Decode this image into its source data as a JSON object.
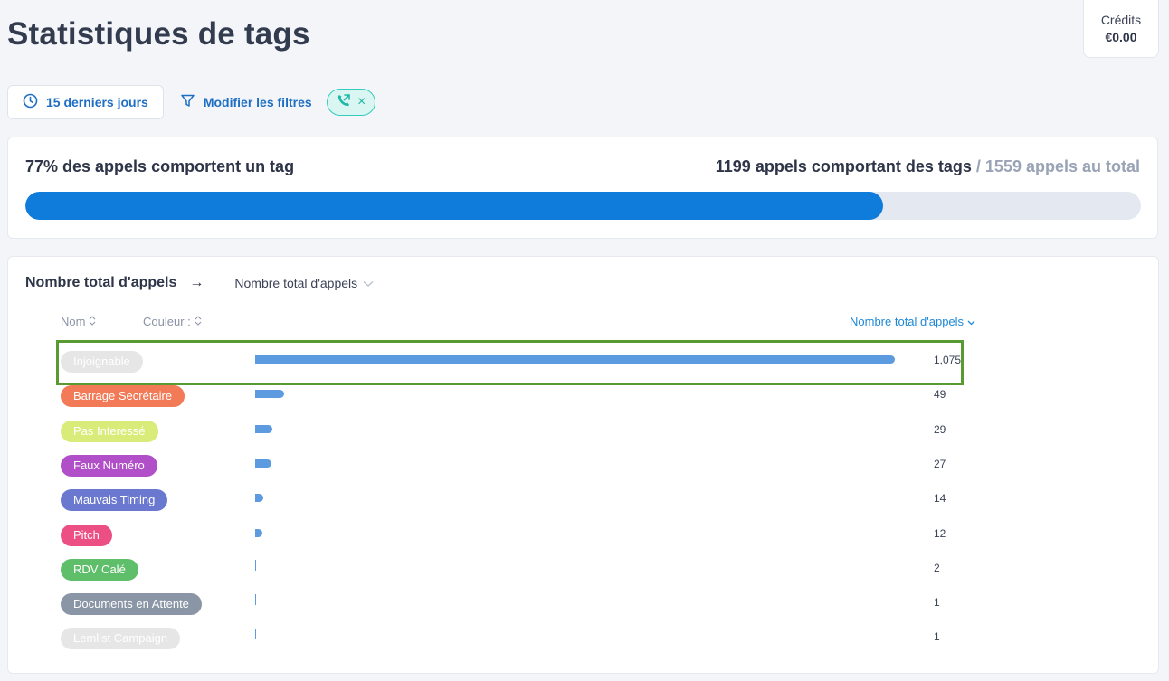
{
  "page": {
    "title": "Statistiques de tags"
  },
  "credits": {
    "label": "Crédits",
    "value": "€0.00"
  },
  "filters": {
    "date_range": "15 derniers jours",
    "modify_label": "Modifier les filtres",
    "chip_close": "×"
  },
  "summary": {
    "percent_text": "77% des appels comportent un tag",
    "tagged_text": "1199 appels comportant des tags",
    "separator": "/",
    "total_text": "1559 appels au total",
    "tagged_calls": 1199,
    "total_calls": 1559
  },
  "table": {
    "title": "Nombre total d'appels",
    "arrow": "→",
    "metric_select": "Nombre total d'appels",
    "columns": {
      "name": "Nom",
      "color": "Couleur :",
      "total": "Nombre total d'appels"
    },
    "max_value": 1075,
    "rows": [
      {
        "name": "Injoignable",
        "display": "1,075",
        "value": 1075,
        "color": "#e6e6e6"
      },
      {
        "name": "Barrage Secrétaire",
        "display": "49",
        "value": 49,
        "color": "#f27a56"
      },
      {
        "name": "Pas Interessé",
        "display": "29",
        "value": 29,
        "color": "#d9ec7a"
      },
      {
        "name": "Faux Numéro",
        "display": "27",
        "value": 27,
        "color": "#b14fc8"
      },
      {
        "name": "Mauvais Timing",
        "display": "14",
        "value": 14,
        "color": "#6a78cf"
      },
      {
        "name": "Pitch",
        "display": "12",
        "value": 12,
        "color": "#ec4f84"
      },
      {
        "name": "RDV Calé",
        "display": "2",
        "value": 2,
        "color": "#5fbe6a"
      },
      {
        "name": "Documents en Attente",
        "display": "1",
        "value": 1,
        "color": "#8a95a5"
      },
      {
        "name": "Lemlist Campaign",
        "display": "1",
        "value": 1,
        "color": "#e6e6e6"
      }
    ]
  },
  "colors": {
    "accent": "#1e6fc4",
    "progress": "#0f7bdb",
    "bar": "#5c9be0",
    "highlight": "#5a9a32",
    "chip_border": "#33cdbd"
  }
}
